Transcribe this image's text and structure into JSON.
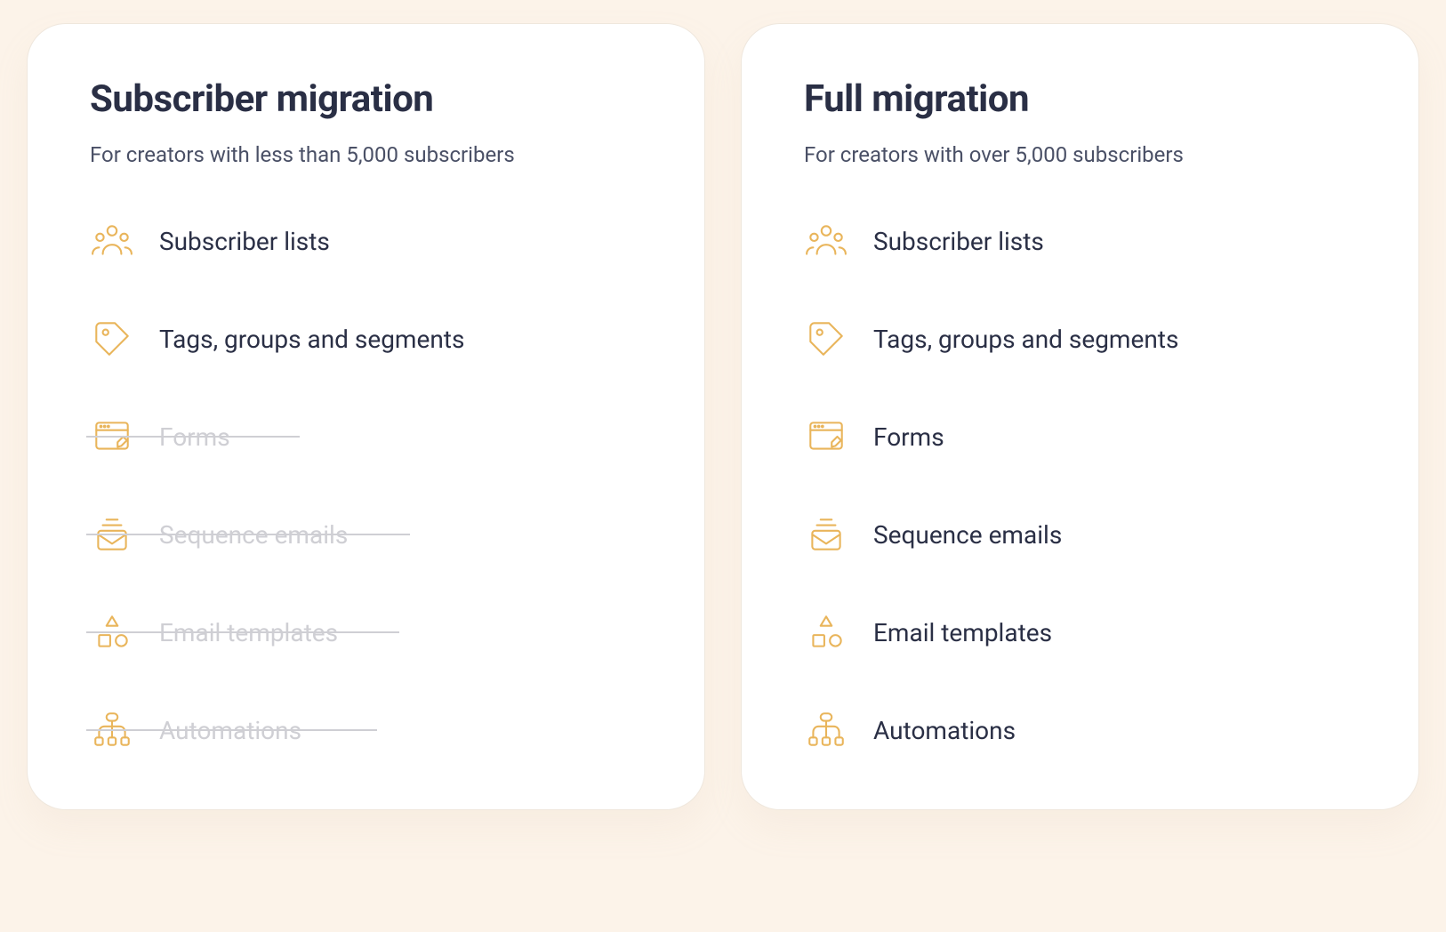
{
  "colors": {
    "accent": "#e9b55b",
    "text": "#2a2f45",
    "muted": "#cfcfd4",
    "bg": "#fcf3e9",
    "card": "#ffffff"
  },
  "cards": {
    "subscriber": {
      "title": "Subscriber migration",
      "subtitle": "For creators with less than 5,000 subscribers",
      "features": {
        "lists": {
          "label": "Subscriber lists",
          "enabled": true,
          "icon": "people-icon"
        },
        "tags": {
          "label": "Tags, groups and segments",
          "enabled": true,
          "icon": "tag-icon"
        },
        "forms": {
          "label": "Forms",
          "enabled": false,
          "icon": "form-icon"
        },
        "sequence": {
          "label": "Sequence emails",
          "enabled": false,
          "icon": "mail-icon"
        },
        "templates": {
          "label": "Email templates",
          "enabled": false,
          "icon": "shapes-icon"
        },
        "automations": {
          "label": "Automations",
          "enabled": false,
          "icon": "hierarchy-icon"
        }
      }
    },
    "full": {
      "title": "Full migration",
      "subtitle": "For creators with over 5,000 subscribers",
      "features": {
        "lists": {
          "label": "Subscriber lists",
          "enabled": true,
          "icon": "people-icon"
        },
        "tags": {
          "label": "Tags, groups and segments",
          "enabled": true,
          "icon": "tag-icon"
        },
        "forms": {
          "label": "Forms",
          "enabled": true,
          "icon": "form-icon"
        },
        "sequence": {
          "label": "Sequence emails",
          "enabled": true,
          "icon": "mail-icon"
        },
        "templates": {
          "label": "Email templates",
          "enabled": true,
          "icon": "shapes-icon"
        },
        "automations": {
          "label": "Automations",
          "enabled": true,
          "icon": "hierarchy-icon"
        }
      }
    }
  }
}
